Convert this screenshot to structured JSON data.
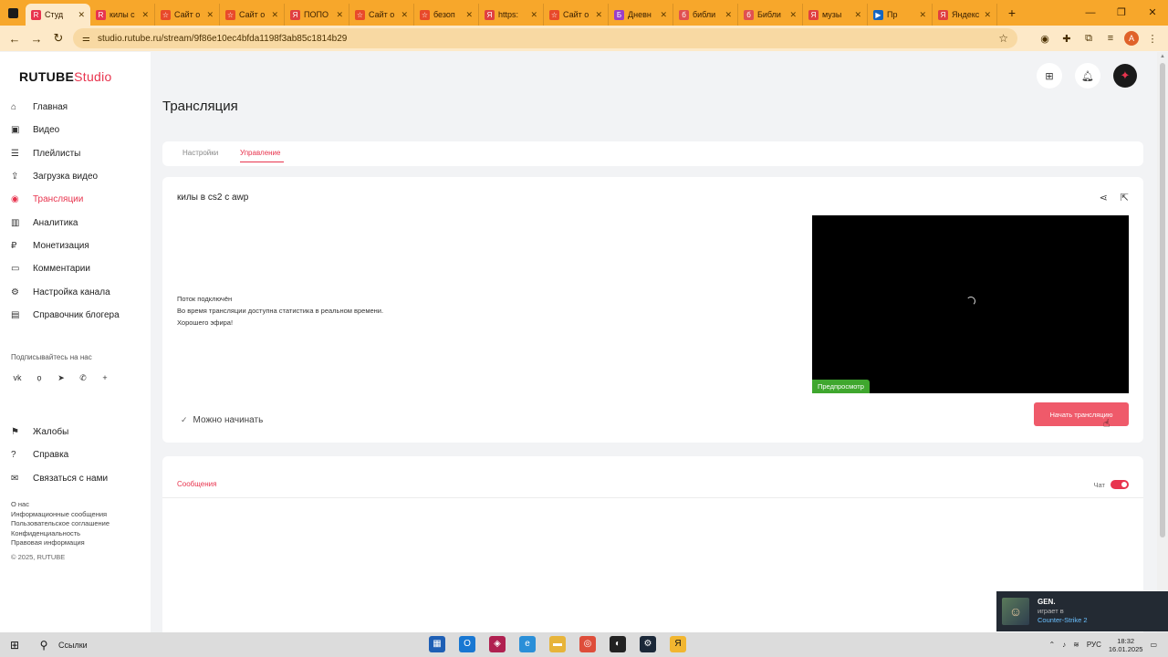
{
  "browser": {
    "tabs": [
      {
        "title": "Студ",
        "color": "#e8344e",
        "letter": "R"
      },
      {
        "title": "килы с",
        "color": "#e8344e",
        "letter": "R"
      },
      {
        "title": "Сайт о",
        "color": "#e84a2a",
        "letter": "☆"
      },
      {
        "title": "Сайт о",
        "color": "#e84a2a",
        "letter": "☆"
      },
      {
        "title": "ПОПО",
        "color": "#e04040",
        "letter": "Я"
      },
      {
        "title": "Сайт о",
        "color": "#e84a2a",
        "letter": "☆"
      },
      {
        "title": "безоп",
        "color": "#e84a2a",
        "letter": "☆"
      },
      {
        "title": "https:",
        "color": "#e04040",
        "letter": "Я"
      },
      {
        "title": "Сайт о",
        "color": "#e84a2a",
        "letter": "☆"
      },
      {
        "title": "Дневн",
        "color": "#9b3ec8",
        "letter": "Б"
      },
      {
        "title": "библи",
        "color": "#e05050",
        "letter": "б"
      },
      {
        "title": "Библи",
        "color": "#e05050",
        "letter": "б"
      },
      {
        "title": "музы",
        "color": "#e04040",
        "letter": "Я"
      },
      {
        "title": "Пр",
        "color": "#1565c0",
        "letter": "▶"
      },
      {
        "title": "Яндекс",
        "color": "#e04040",
        "letter": "Я"
      }
    ],
    "url": "studio.rutube.ru/stream/9f86e10ec4bfda1198f3ab85c1814b29",
    "profile_letter": "A"
  },
  "sidebar": {
    "logo_main": "RUTUBE",
    "logo_studio": "Studio",
    "items": [
      {
        "label": "Главная",
        "icon": "⌂",
        "name": "sidebar-item-home"
      },
      {
        "label": "Видео",
        "icon": "▣",
        "name": "sidebar-item-video"
      },
      {
        "label": "Плейлисты",
        "icon": "☰",
        "name": "sidebar-item-playlists"
      },
      {
        "label": "Загрузка видео",
        "icon": "⇪",
        "name": "sidebar-item-upload"
      },
      {
        "label": "Трансляции",
        "icon": "◉",
        "name": "sidebar-item-streams",
        "active": true
      },
      {
        "label": "Аналитика",
        "icon": "▥",
        "name": "sidebar-item-analytics"
      },
      {
        "label": "Монетизация",
        "icon": "₽",
        "name": "sidebar-item-monetization"
      },
      {
        "label": "Комментарии",
        "icon": "▭",
        "name": "sidebar-item-comments"
      },
      {
        "label": "Настройка канала",
        "icon": "⚙",
        "name": "sidebar-item-channel-settings"
      },
      {
        "label": "Справочник блогера",
        "icon": "▤",
        "name": "sidebar-item-blogger-guide"
      }
    ],
    "follow_label": "Подписывайтесь на нас",
    "socials": [
      "vk",
      "ok",
      "tg",
      "vb",
      "+"
    ],
    "bottom_items": [
      {
        "label": "Жалобы",
        "icon": "⚑",
        "name": "sidebar-item-complaints"
      },
      {
        "label": "Справка",
        "icon": "?",
        "name": "sidebar-item-help"
      },
      {
        "label": "Связаться с нами",
        "icon": "✉",
        "name": "sidebar-item-contact"
      }
    ],
    "footer_links": [
      "О нас",
      "Информационные сообщения",
      "Пользовательское соглашение",
      "Конфиденциальность",
      "Правовая информация"
    ],
    "copyright": "© 2025, RUTUBE"
  },
  "page": {
    "title": "Трансляция",
    "tabs": [
      "Настройки",
      "Управление"
    ],
    "active_tab": 1,
    "stream_title": "килы в cs2 с awp",
    "status_lines": [
      "Поток подключён",
      "Во время трансляции доступна статистика в реальном времени.",
      "Хорошего эфира!"
    ],
    "preview_label": "Предпросмотр",
    "ready_label": "Можно начинать",
    "start_button": "Начать трансляцию",
    "chat_tab": "Сообщения",
    "chat_toggle_label": "Чат"
  },
  "toast": {
    "name": "GEN.",
    "playing": "играет в",
    "game": "Counter-Strike 2"
  },
  "taskbar": {
    "search_label": "Ссылки",
    "lang": "РУС",
    "time": "18:32",
    "date": "16.01.2025"
  },
  "colors": {
    "accent": "#e8344e",
    "preview_badge": "#3fa72e",
    "browser_frame": "#f7a72b"
  }
}
